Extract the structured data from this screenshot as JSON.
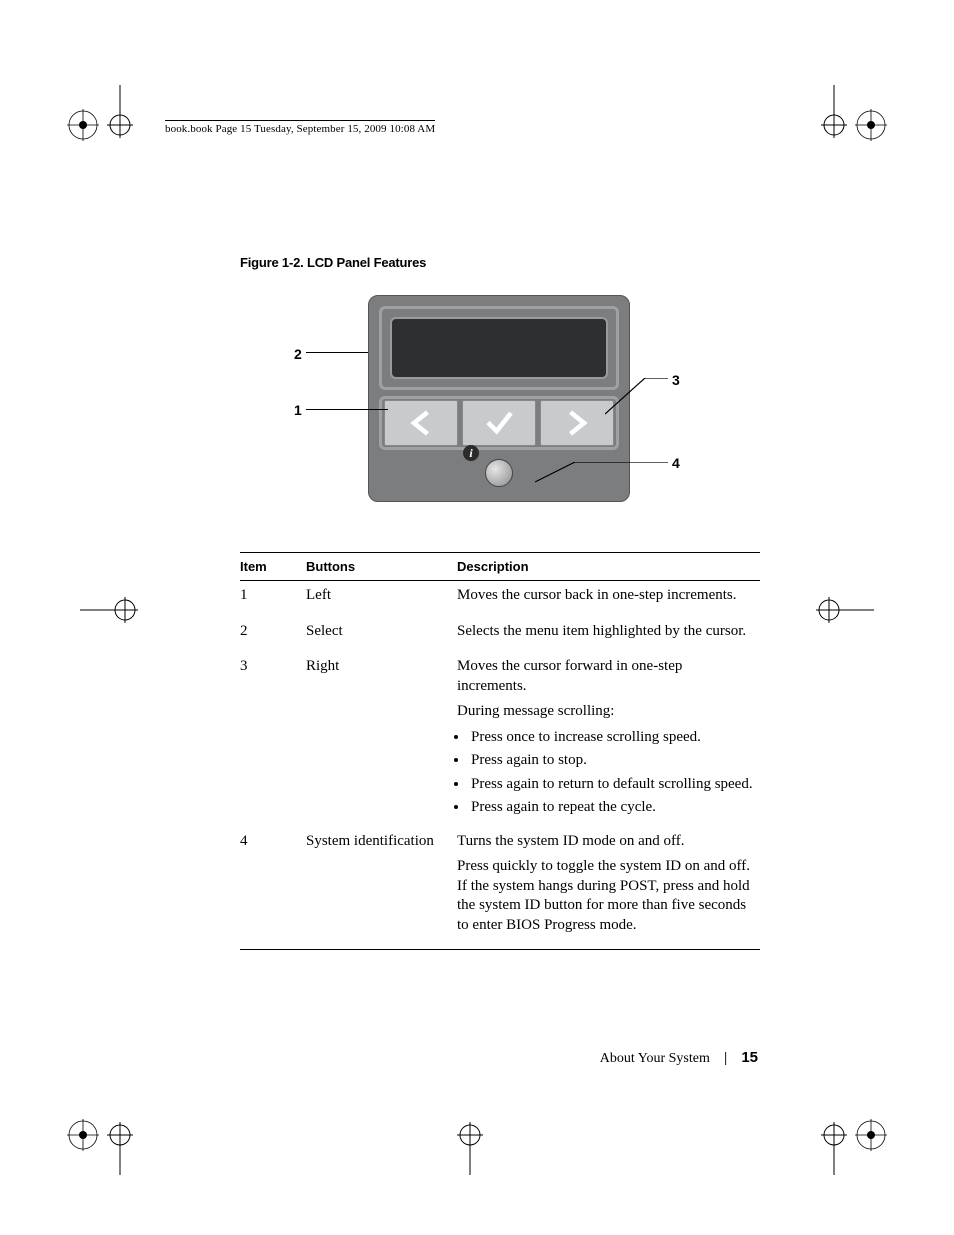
{
  "running_header": "book.book  Page 15  Tuesday, September 15, 2009  10:08 AM",
  "figure_caption": "Figure 1-2.    LCD Panel Features",
  "callouts": {
    "c1": "1",
    "c2": "2",
    "c3": "3",
    "c4": "4"
  },
  "table": {
    "headers": {
      "item": "Item",
      "buttons": "Buttons",
      "description": "Description"
    },
    "rows": [
      {
        "item": "1",
        "button": "Left",
        "desc": [
          {
            "type": "p",
            "text": "Moves the cursor back in one-step increments."
          }
        ]
      },
      {
        "item": "2",
        "button": "Select",
        "desc": [
          {
            "type": "p",
            "text": "Selects the menu item highlighted by the cursor."
          }
        ]
      },
      {
        "item": "3",
        "button": "Right",
        "desc": [
          {
            "type": "p",
            "text": "Moves the cursor forward in one-step increments."
          },
          {
            "type": "p",
            "text": "During message scrolling:"
          },
          {
            "type": "li",
            "text": "Press once to increase scrolling speed."
          },
          {
            "type": "li",
            "text": "Press again to stop."
          },
          {
            "type": "li",
            "text": "Press again to return to default scrolling speed."
          },
          {
            "type": "li",
            "text": "Press again to repeat the cycle."
          }
        ]
      },
      {
        "item": "4",
        "button": "System identification",
        "desc": [
          {
            "type": "p",
            "text": "Turns the system ID mode on and off."
          },
          {
            "type": "p",
            "text": "Press quickly to toggle the system ID on and off. If the system hangs during POST, press and hold the system ID button for more than five seconds to enter BIOS Progress mode."
          }
        ]
      }
    ]
  },
  "footer": {
    "section": "About Your System",
    "page": "15"
  },
  "icons": {
    "info": "i"
  }
}
